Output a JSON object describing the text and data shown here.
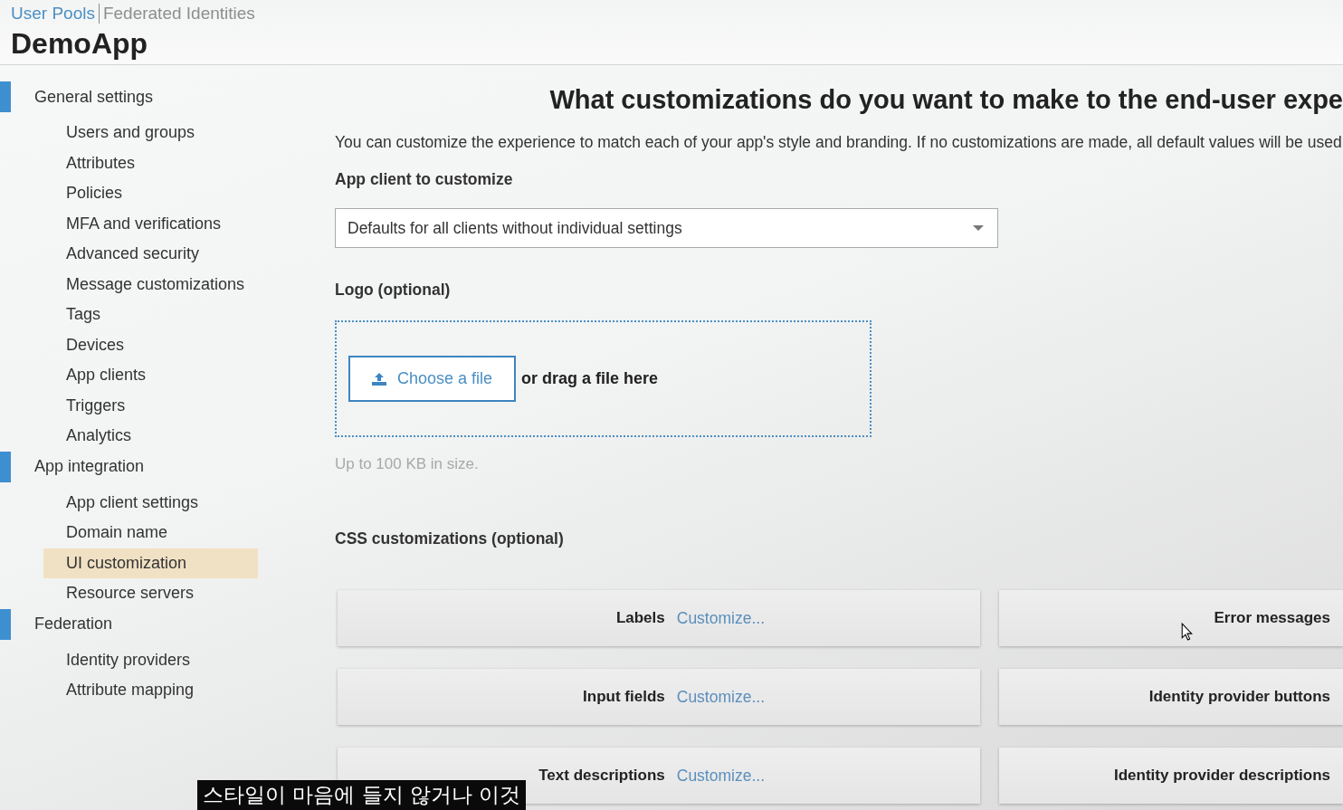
{
  "header": {
    "tabs": [
      {
        "label": "User Pools",
        "selected": true
      },
      {
        "label": "Federated Identities",
        "selected": false
      }
    ],
    "title": "DemoApp"
  },
  "sidebar": {
    "groups": [
      {
        "label": "General settings",
        "items": [
          {
            "label": "Users and groups",
            "selected": false
          },
          {
            "label": "Attributes",
            "selected": false
          },
          {
            "label": "Policies",
            "selected": false
          },
          {
            "label": "MFA and verifications",
            "selected": false
          },
          {
            "label": "Advanced security",
            "selected": false
          },
          {
            "label": "Message customizations",
            "selected": false
          },
          {
            "label": "Tags",
            "selected": false
          },
          {
            "label": "Devices",
            "selected": false
          },
          {
            "label": "App clients",
            "selected": false
          },
          {
            "label": "Triggers",
            "selected": false
          },
          {
            "label": "Analytics",
            "selected": false
          }
        ]
      },
      {
        "label": "App integration",
        "items": [
          {
            "label": "App client settings",
            "selected": false
          },
          {
            "label": "Domain name",
            "selected": false
          },
          {
            "label": "UI customization",
            "selected": true
          },
          {
            "label": "Resource servers",
            "selected": false
          }
        ]
      },
      {
        "label": "Federation",
        "items": [
          {
            "label": "Identity providers",
            "selected": false
          },
          {
            "label": "Attribute mapping",
            "selected": false
          }
        ]
      }
    ]
  },
  "main": {
    "heading": "What customizations do you want to make to the end-user expe",
    "description": "You can customize the experience to match each of your app's style and branding. If no customizations are made, all default values will be used.",
    "app_client": {
      "label": "App client to customize",
      "value": "Defaults for all clients without individual settings"
    },
    "logo": {
      "label": "Logo (optional)",
      "button": "Choose a file",
      "drop_hint": "or drag a file here",
      "size_note": "Up to 100 KB in size."
    },
    "css": {
      "label": "CSS customizations (optional)",
      "cards": [
        {
          "label": "Labels",
          "link": "Customize..."
        },
        {
          "label": "Error messages"
        },
        {
          "label": "Input fields",
          "link": "Customize..."
        },
        {
          "label": "Identity provider buttons"
        },
        {
          "label": "Text descriptions",
          "link": "Customize..."
        },
        {
          "label": "Identity provider descriptions"
        }
      ]
    }
  },
  "subtitle": "스타일이 마음에 들지 않거나 이것"
}
